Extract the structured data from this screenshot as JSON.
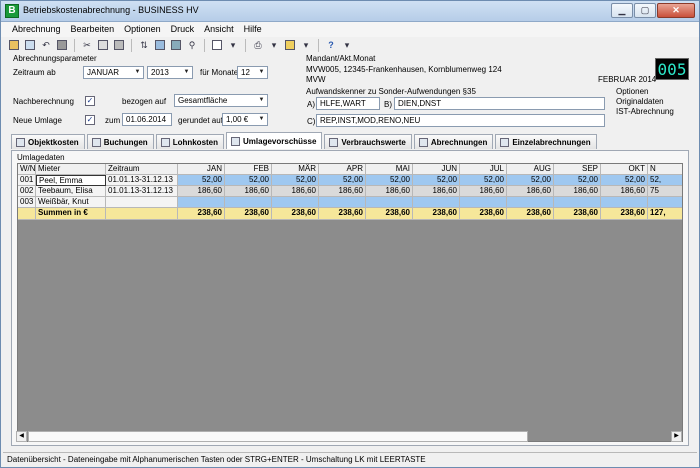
{
  "window": {
    "title": "Betriebskostenabrechnung - BUSINESS HV",
    "app_icon_letter": "B"
  },
  "menu": [
    "Abrechnung",
    "Bearbeiten",
    "Optionen",
    "Druck",
    "Ansicht",
    "Hilfe"
  ],
  "params": {
    "group_label": "Abrechnungsparameter",
    "zeitraum_label": "Zeitraum ab",
    "month_value": "JANUAR",
    "year_value": "2013",
    "fuer_monate_label": "für Monate",
    "months_value": "12",
    "nachberechnung_label": "Nachberechnung",
    "nachberechnung_checked": "✓",
    "bezogen_label": "bezogen auf",
    "bezogen_value": "Gesamtfläche",
    "neue_umlage_label": "Neue Umlage",
    "neue_umlage_checked": "✓",
    "zum_label": "zum",
    "zum_value": "01.06.2014",
    "gerundet_label": "gerundet auf",
    "gerundet_value": "1,00 €"
  },
  "mandant": {
    "label": "Mandant/Akt.Monat",
    "line1": "MVW005, 12345-Frankenhausen, Kornblumenweg 124",
    "line2": "MVW",
    "month": "FEBRUAR 2014",
    "badge": "005"
  },
  "sonder": {
    "label": "Aufwandskenner zu Sonder-Aufwendungen §35",
    "a_label": "A)",
    "a_value": "HLFE,WART",
    "b_label": "B)",
    "b_value": "DIEN,DNST",
    "c_label": "C)",
    "c_value": "REP,INST,MOD,RENO,NEU"
  },
  "optionen": {
    "label": "Optionen",
    "line1": "Originaldaten",
    "line2": "IST-Abrechnung"
  },
  "tabs": [
    "Objektkosten",
    "Buchungen",
    "Lohnkosten",
    "Umlagevorschüsse",
    "Verbrauchswerte",
    "Abrechnungen",
    "Einzelabrechnungen"
  ],
  "active_tab": 3,
  "umlage": {
    "label": "Umlagedaten",
    "headers": {
      "wn": "W/Nr",
      "mieter": "Mieter",
      "zeitraum": "Zeitraum",
      "months": [
        "JAN",
        "FEB",
        "MÄR",
        "APR",
        "MAI",
        "JUN",
        "JUL",
        "AUG",
        "SEP",
        "OKT",
        "N"
      ]
    },
    "rows": [
      {
        "wn": "001",
        "mieter": "Peel, Emma",
        "zeitraum": "01.01.13-31.12.13",
        "values": [
          "52,00",
          "52,00",
          "52,00",
          "52,00",
          "52,00",
          "52,00",
          "52,00",
          "52,00",
          "52,00",
          "52,00",
          "52,"
        ]
      },
      {
        "wn": "002",
        "mieter": "Teebaum, Elisa",
        "zeitraum": "01.01.13-31.12.13",
        "values": [
          "186,60",
          "186,60",
          "186,60",
          "186,60",
          "186,60",
          "186,60",
          "186,60",
          "186,60",
          "186,60",
          "186,60",
          "75"
        ]
      },
      {
        "wn": "003",
        "mieter": "Weißbär, Knut",
        "zeitraum": "",
        "values": [
          "",
          "",
          "",
          "",
          "",
          "",
          "",
          "",
          "",
          "",
          ""
        ]
      }
    ],
    "sum_label": "Summen in €",
    "sums": [
      "238,60",
      "238,60",
      "238,60",
      "238,60",
      "238,60",
      "238,60",
      "238,60",
      "238,60",
      "238,60",
      "238,60",
      "127,"
    ]
  },
  "status": "Datenübersicht - Dateneingabe mit Alphanumerischen Tasten oder STRG+ENTER - Umschaltung LK mit LEERTASTE"
}
